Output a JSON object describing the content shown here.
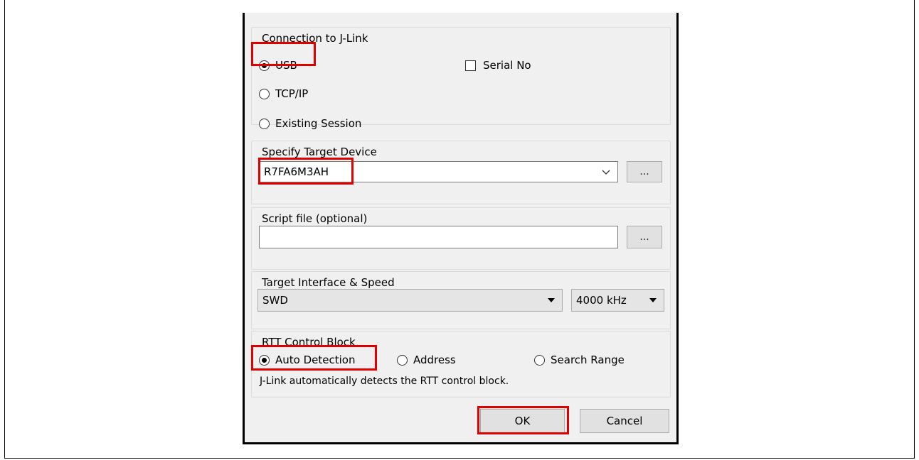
{
  "connection": {
    "title": "Connection to J-Link",
    "usb_label": "USB",
    "tcpip_label": "TCP/IP",
    "existing_session_label": "Existing Session",
    "serial_no_label": "Serial No",
    "selected": "USB",
    "serial_no_checked": false
  },
  "target_device": {
    "title": "Specify Target Device",
    "value": "R7FA6M3AH",
    "browse_label": "..."
  },
  "script_file": {
    "title": "Script file (optional)",
    "value": "",
    "browse_label": "..."
  },
  "interface": {
    "title": "Target Interface & Speed",
    "interface_value": "SWD",
    "speed_value": "4000 kHz"
  },
  "rtt": {
    "title": "RTT Control Block",
    "auto_detection_label": "Auto Detection",
    "address_label": "Address",
    "search_range_label": "Search Range",
    "selected": "Auto Detection",
    "description": "J-Link automatically detects the RTT control block."
  },
  "buttons": {
    "ok_label": "OK",
    "cancel_label": "Cancel"
  },
  "colors": {
    "highlight": "#e00000",
    "dialog_bg": "#f0f0f0"
  }
}
